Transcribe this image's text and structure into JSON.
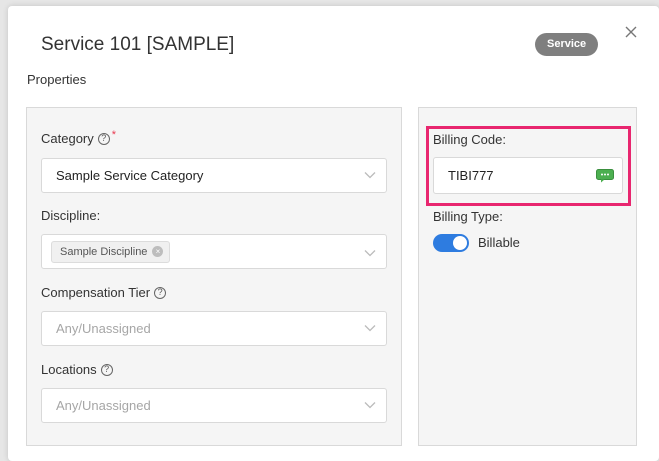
{
  "modal": {
    "title": "Service 101 [SAMPLE]",
    "badge": "Service",
    "section_label": "Properties"
  },
  "left_panel": {
    "category": {
      "label": "Category",
      "required_mark": "*",
      "value": "Sample Service Category"
    },
    "discipline": {
      "label": "Discipline:",
      "chip": "Sample Discipline"
    },
    "compensation_tier": {
      "label": "Compensation Tier",
      "placeholder": "Any/Unassigned"
    },
    "locations": {
      "label": "Locations",
      "placeholder": "Any/Unassigned"
    }
  },
  "right_panel": {
    "billing_code": {
      "label": "Billing Code:",
      "value": "TIBI777"
    },
    "billing_type": {
      "label": "Billing Type:",
      "toggle_label": "Billable",
      "toggle_on": true
    }
  },
  "help_glyph": "?",
  "chip_remove_glyph": "×",
  "colors": {
    "accent": "#2e7ce0",
    "highlight": "#e8266f",
    "badge": "#7f7f7f",
    "required": "#e8384f"
  }
}
